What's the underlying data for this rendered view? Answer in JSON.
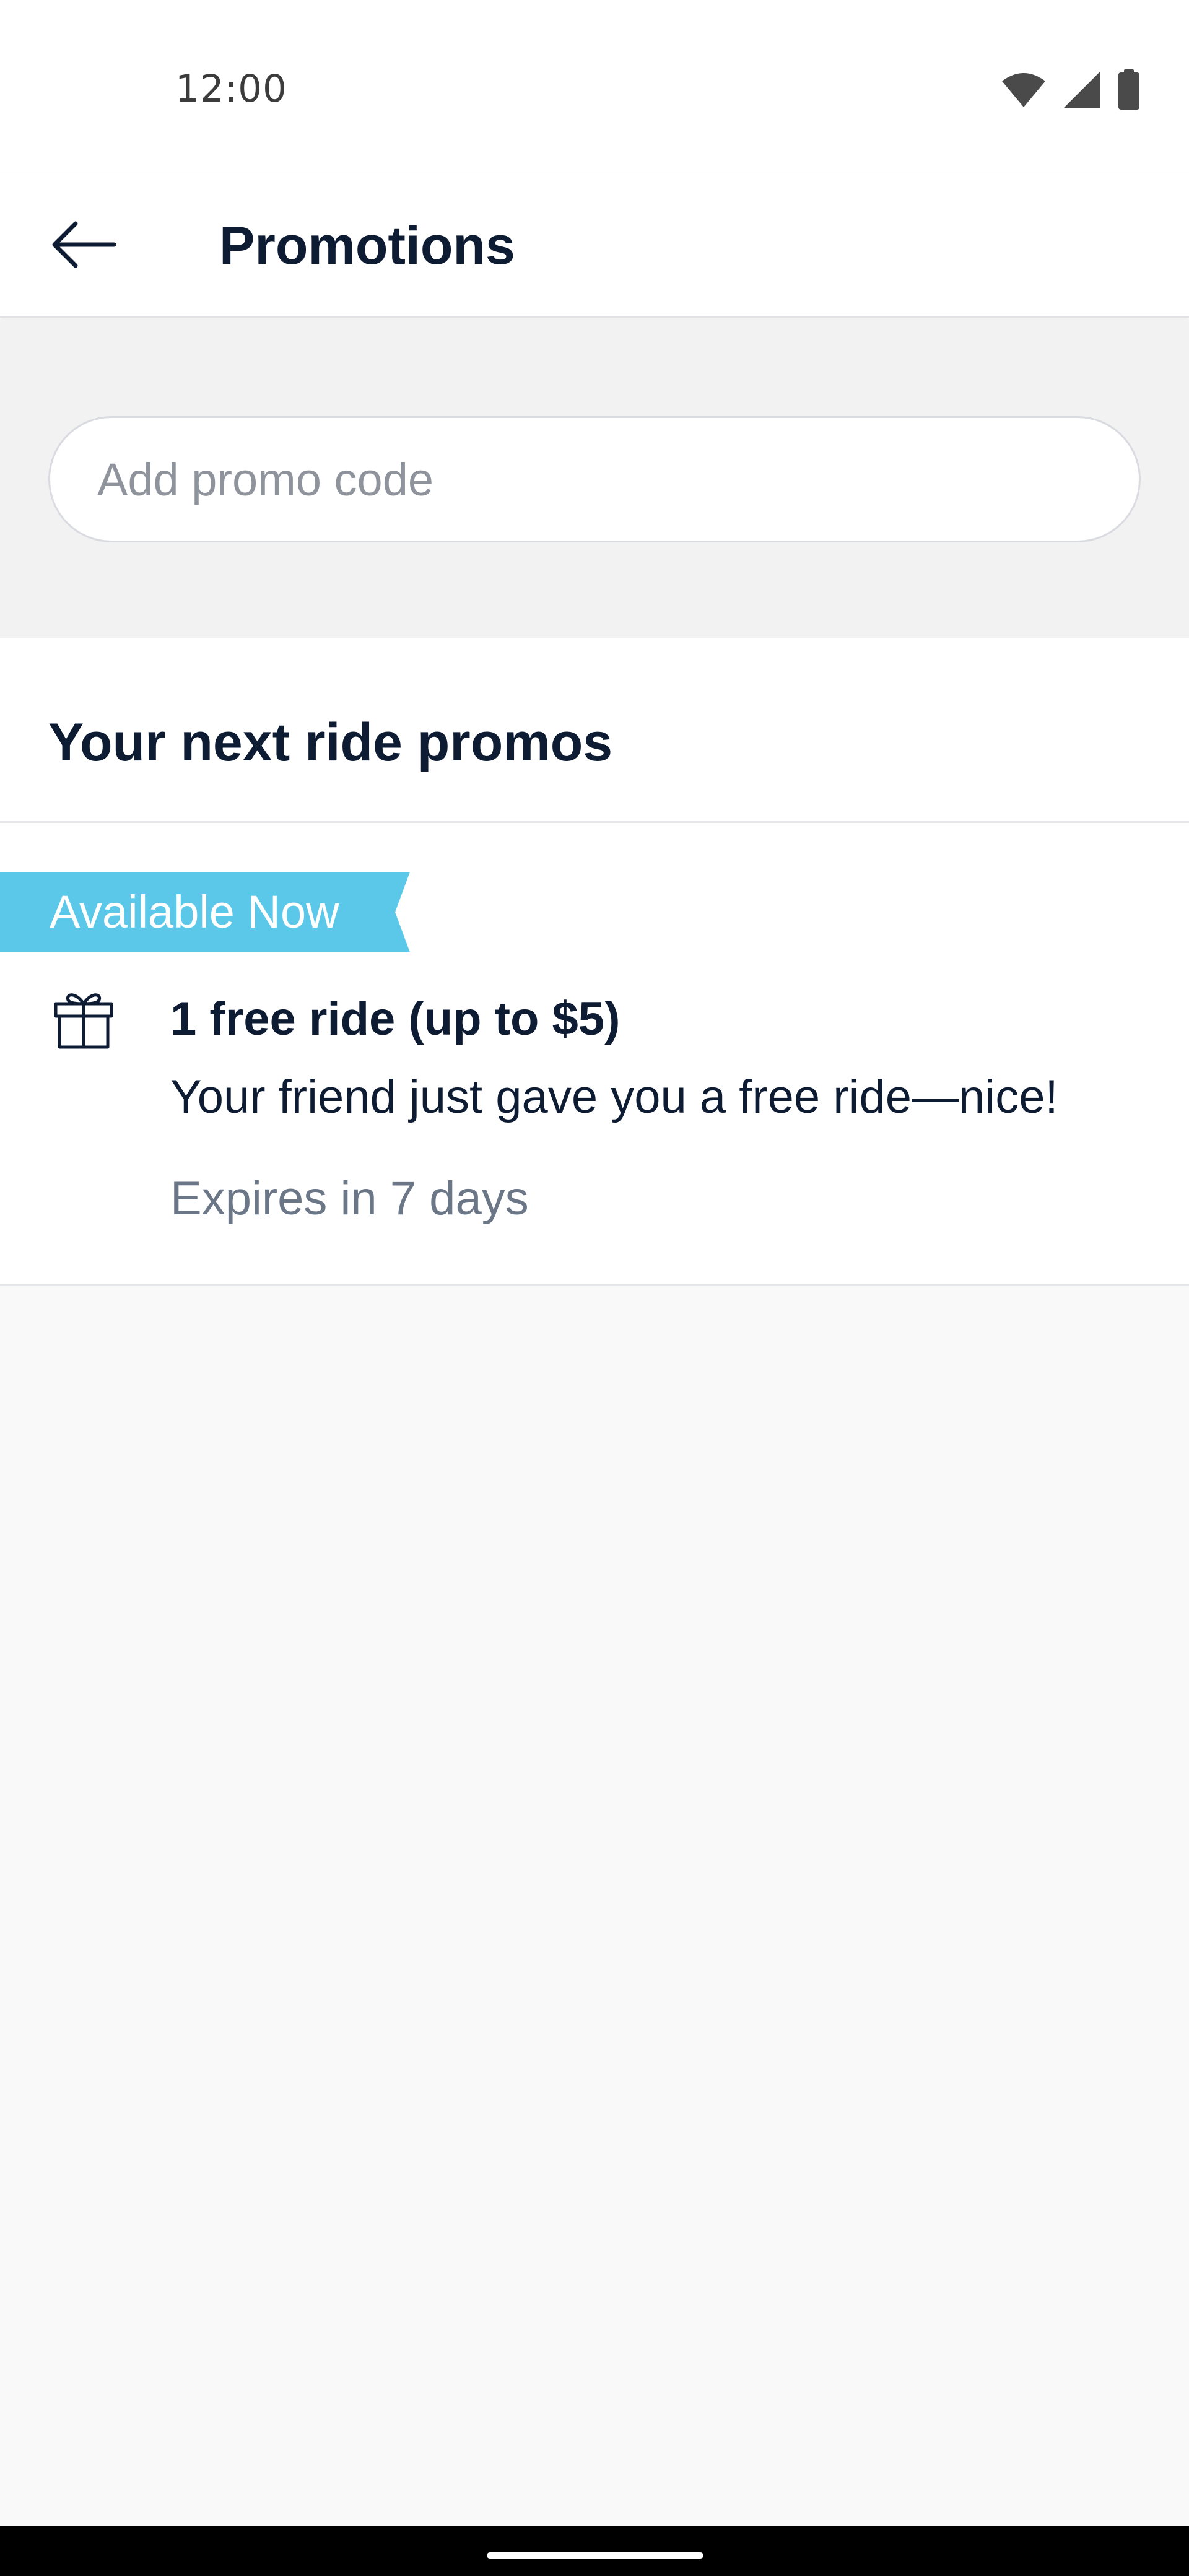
{
  "status_bar": {
    "time": "12:00",
    "icons": [
      "wifi-icon",
      "signal-icon",
      "battery-icon"
    ]
  },
  "header": {
    "title": "Promotions",
    "back_icon": "arrow-left-icon"
  },
  "promo_input": {
    "placeholder": "Add promo code",
    "value": ""
  },
  "section": {
    "heading": "Your next ride promos",
    "promos": [
      {
        "badge": "Available Now",
        "icon": "gift-icon",
        "title": "1 free ride (up to $5)",
        "description": "Your friend just gave you a free ride—nice!",
        "expiry": "Expires in 7 days"
      }
    ]
  },
  "colors": {
    "text_primary": "#0d1b33",
    "text_secondary": "#6b7686",
    "badge_background": "#5bc8ea",
    "page_background": "#f9f9f9"
  }
}
